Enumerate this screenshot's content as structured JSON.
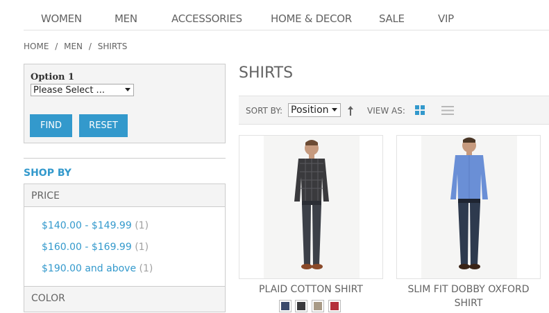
{
  "nav": {
    "items": [
      "WOMEN",
      "MEN",
      "ACCESSORIES",
      "HOME & DECOR",
      "SALE",
      "VIP"
    ]
  },
  "breadcrumb": {
    "home": "HOME",
    "sep1": "/",
    "men": "MEN",
    "sep2": "/",
    "current": "SHIRTS"
  },
  "filter": {
    "option_label": "Option 1",
    "select_value": "Please Select ...",
    "find_label": "FIND",
    "reset_label": "RESET"
  },
  "shop_by": {
    "title": "SHOP BY",
    "price_header": "PRICE",
    "price_ranges": [
      {
        "label": "$140.00 - $149.99",
        "count": "(1)"
      },
      {
        "label": "$160.00 - $169.99",
        "count": "(1)"
      },
      {
        "label": "$190.00 and above",
        "count": "(1)"
      }
    ],
    "color_header": "COLOR"
  },
  "category": {
    "title": "SHIRTS"
  },
  "toolbar": {
    "sort_label": "SORT BY:",
    "sort_value": "Position",
    "view_label": "VIEW AS:",
    "accent_color": "#3399cc"
  },
  "products": [
    {
      "name": "PLAID COTTON SHIRT",
      "shirt_color": "#3a3a3d",
      "pants_color": "#3c4048"
    },
    {
      "name_line1": "SLIM FIT DOBBY OXFORD",
      "name_line2": "SHIRT",
      "shirt_color": "#6a8fd6",
      "pants_color": "#2e3a4e"
    }
  ],
  "swatches": [
    "#3b4a6b",
    "#3a3a3d",
    "#a89a86",
    "#b5303b"
  ]
}
